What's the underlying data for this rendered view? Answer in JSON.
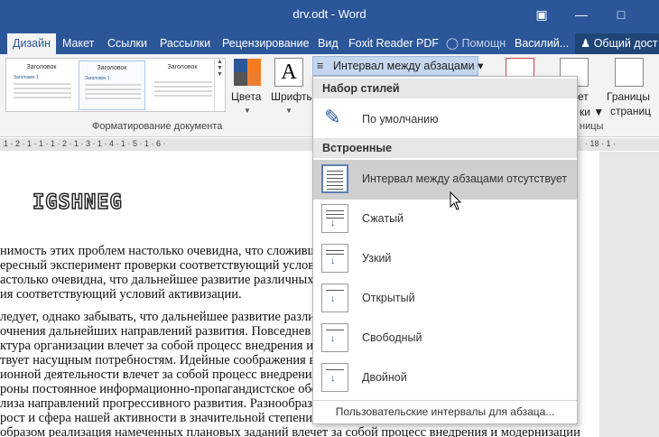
{
  "window": {
    "title": "drv.odt - Word"
  },
  "tabs": [
    {
      "label": "Дизайн",
      "active": true
    },
    {
      "label": "Макет"
    },
    {
      "label": "Ссылки"
    },
    {
      "label": "Рассылки"
    },
    {
      "label": "Рецензирование"
    },
    {
      "label": "Вид"
    },
    {
      "label": "Foxit Reader PDF"
    },
    {
      "label": "Помощн"
    },
    {
      "label": "Василий..."
    }
  ],
  "share": {
    "label": "Общий дост"
  },
  "ribbon": {
    "gallery_items": [
      {
        "heading": "Заголовок",
        "t1": "Заголовок 1"
      },
      {
        "heading": "Заголовок",
        "t1": "Заголовок 1"
      },
      {
        "heading": "Заголовок",
        "t1": ""
      }
    ],
    "group_label": "Форматирование документа",
    "colors": "Цвета",
    "fonts": "Шрифты",
    "interval": "Интервал между абзацами",
    "right_a": "ет",
    "right_b": "ки",
    "borders": "Границы\nстраниц",
    "borders_1": "Границы",
    "borders_2": "страниц",
    "right_group": "ницы"
  },
  "ruler": {
    "left": "1 · 2 · 1 · 1 · 1 · 2 · 1 · 3 · 1 · 4 · 1 · 5 · 1 · 6 ·",
    "right": "· 18 · 1 ·"
  },
  "document": {
    "logo": "IGSHNEG",
    "lines": [
      "нимость этих проблем настолько очевидна, что сложившая",
      "ересный эксперимент проверки соответствующий услов",
      "астолько очевидна, что дальнейшее развитие различных фор",
      "ия соответствующий условий активизации.",
      "ледует, однако забывать, что дальнейшее развитие различ",
      "очнения дальнейших направлений развития. Повседнев",
      "ктура организации влечет за собой процесс внедрения и м",
      "твует насущным потребностям. Идейные соображения вы",
      "ионной деятельности влечет за собой процесс внедрения",
      "роны постоянное информационно-пропагандистское обесп",
      "лиза направлений прогрессивного развития. Разнообразнь",
      " рост и сфера нашей активности в значительной степени о",
      " образом реализация намеченных плановых заданий влечет за собой процесс внедрения и модернизации"
    ]
  },
  "menu": {
    "section_styles": "Набор стилей",
    "default": "По умолчанию",
    "section_builtin": "Встроенные",
    "items": [
      {
        "label": "Интервал между абзацами отсутствует",
        "highlighted": true
      },
      {
        "label": "Сжатый"
      },
      {
        "label": "Узкий"
      },
      {
        "label": "Открытый"
      },
      {
        "label": "Свободный"
      },
      {
        "label": "Двойной"
      }
    ],
    "footer": "Пользовательские интервалы для абзаца..."
  },
  "colors": {
    "accent": "#2b579a",
    "highlight": "#cfcfcf"
  }
}
